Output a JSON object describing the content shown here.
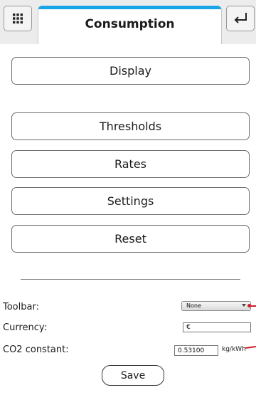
{
  "header": {
    "title": "Consumption",
    "accent_color": "#19a6e6",
    "left_icon": "grid-menu-icon",
    "right_icon": "return-arrow-icon"
  },
  "menu": {
    "items": [
      {
        "label": "Display"
      },
      {
        "label": "Thresholds"
      },
      {
        "label": "Rates"
      },
      {
        "label": "Settings"
      },
      {
        "label": "Reset"
      }
    ]
  },
  "settings": {
    "toolbar_label": "Toolbar:",
    "toolbar_value": "None",
    "currency_label": "Currency:",
    "currency_value": "€",
    "co2_label": "CO2 constant:",
    "co2_value": "0.53100",
    "co2_unit": "kg/kWh",
    "marker_color": "#d0202a"
  },
  "save_label": "Save"
}
